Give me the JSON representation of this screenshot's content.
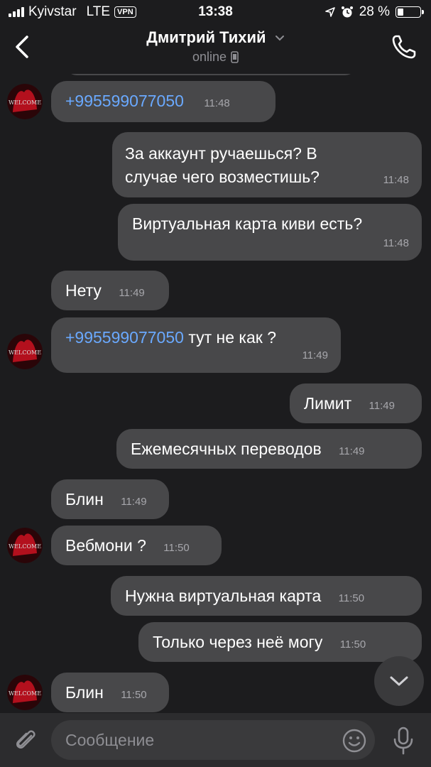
{
  "status_bar": {
    "carrier": "Kyivstar",
    "network": "LTE",
    "vpn": "VPN",
    "time": "13:38",
    "battery": "28 %"
  },
  "header": {
    "name": "Дмитрий Тихий",
    "status": "online"
  },
  "messages": [
    {
      "side": "in",
      "text": "+995599077050",
      "link": true,
      "time": "11:48"
    },
    {
      "side": "out",
      "text": "За аккаунт ручаешься? В случае чего возместишь?",
      "time": "11:48"
    },
    {
      "side": "out",
      "text": "Виртуальная карта киви есть?",
      "time": "11:48"
    },
    {
      "side": "in",
      "text": "Нету",
      "time": "11:49"
    },
    {
      "side": "in",
      "text": "+995599077050",
      "link": true,
      "suffix": " тут не как ?",
      "time": "11:49"
    },
    {
      "side": "out",
      "text": "Лимит",
      "time": "11:49"
    },
    {
      "side": "out",
      "text": "Ежемесячных переводов",
      "time": "11:49"
    },
    {
      "side": "in",
      "text": "Блин",
      "time": "11:49"
    },
    {
      "side": "in",
      "text": "Вебмони ?",
      "time": "11:50"
    },
    {
      "side": "out",
      "text": "Нужна виртуальная карта",
      "time": "11:50"
    },
    {
      "side": "out",
      "text": "Только через неё могу",
      "time": "11:50"
    },
    {
      "side": "in",
      "text": "Блин",
      "time": "11:50"
    }
  ],
  "input": {
    "placeholder": "Сообщение"
  },
  "avatar_text": "WELCOME",
  "colors": {
    "background": "#1c1c1e",
    "bubble": "#48484a",
    "link": "#6aa9ff",
    "time": "#a7a7ac"
  }
}
